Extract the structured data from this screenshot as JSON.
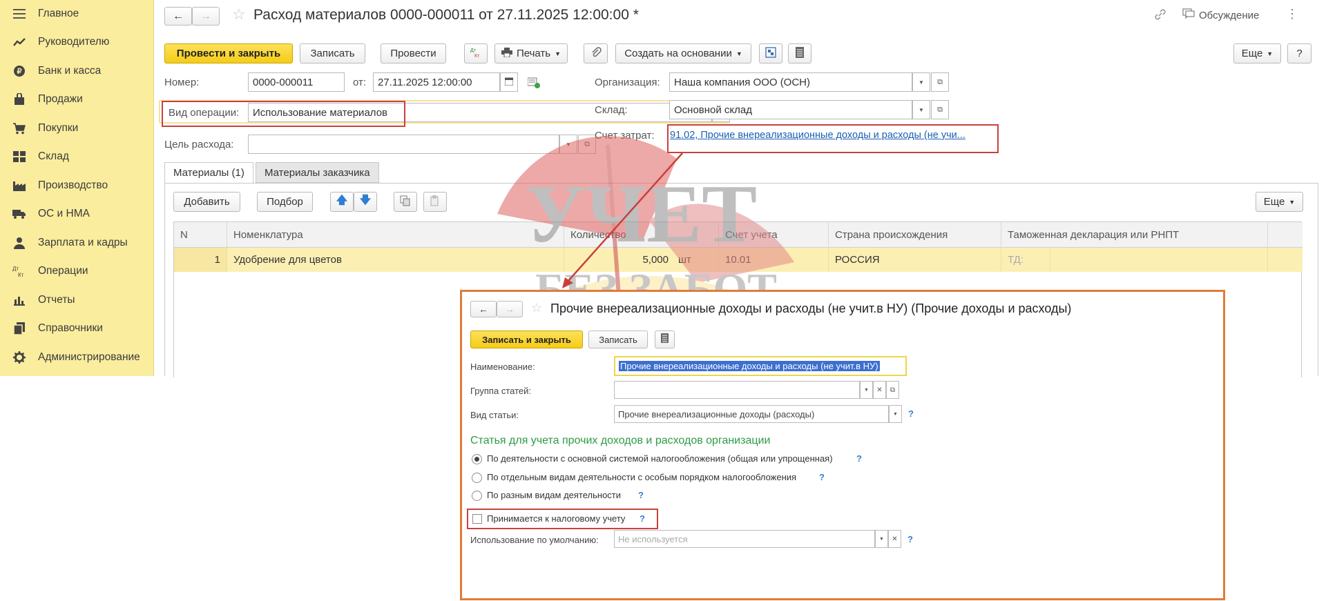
{
  "sidebar": {
    "items": [
      {
        "label": "Главное",
        "icon": "menu-icon"
      },
      {
        "label": "Руководителю",
        "icon": "trend-up-icon"
      },
      {
        "label": "Банк и касса",
        "icon": "coin-icon"
      },
      {
        "label": "Продажи",
        "icon": "shopping-bag-icon"
      },
      {
        "label": "Покупки",
        "icon": "cart-icon"
      },
      {
        "label": "Склад",
        "icon": "warehouse-icon"
      },
      {
        "label": "Производство",
        "icon": "factory-icon"
      },
      {
        "label": "ОС и НМА",
        "icon": "truck-icon"
      },
      {
        "label": "Зарплата и кадры",
        "icon": "person-icon"
      },
      {
        "label": "Операции",
        "icon": "dt-kt-icon"
      },
      {
        "label": "Отчеты",
        "icon": "bar-chart-icon"
      },
      {
        "label": "Справочники",
        "icon": "books-icon"
      },
      {
        "label": "Администрирование",
        "icon": "gear-icon"
      }
    ]
  },
  "header": {
    "title": "Расход материалов 0000-000011 от 27.11.2025 12:00:00 *",
    "discussion": "Обсуждение"
  },
  "toolbar": {
    "post_close": "Провести и закрыть",
    "save": "Записать",
    "post": "Провести",
    "dtkt": "Дт Кт",
    "print": "Печать",
    "create_based": "Создать на основании",
    "more": "Еще",
    "help": "?"
  },
  "form": {
    "number_label": "Номер:",
    "number_value": "0000-000011",
    "date_label": "от:",
    "date_value": "27.11.2025 12:00:00",
    "operation_label": "Вид операции:",
    "operation_value": "Использование материалов",
    "purpose_label": "Цель расхода:",
    "purpose_value": "",
    "org_label": "Организация:",
    "org_value": "Наша компания ООО (ОСН)",
    "warehouse_label": "Склад:",
    "warehouse_value": "Основной склад",
    "account_label": "Счет затрат:",
    "account_value": "91.02, Прочие внереализационные доходы и расходы (не учи..."
  },
  "tabs": [
    {
      "label": "Материалы (1)"
    },
    {
      "label": "Материалы заказчика"
    }
  ],
  "table_toolbar": {
    "add": "Добавить",
    "pick": "Подбор",
    "more": "Еще"
  },
  "table": {
    "headers": [
      "N",
      "Номенклатура",
      "Количество",
      "Счет учета",
      "Страна происхождения",
      "Таможенная декларация или РНПТ"
    ],
    "rows": [
      {
        "n": "1",
        "name": "Удобрение для цветов",
        "qty": "5,000",
        "unit": "шт",
        "account": "10.01",
        "country": "РОССИЯ",
        "customs": "ТД:"
      }
    ]
  },
  "popup": {
    "title": "Прочие внереализационные доходы и расходы (не учит.в НУ) (Прочие доходы и расходы)",
    "save_close": "Записать и закрыть",
    "save": "Записать",
    "name_label": "Наименование:",
    "name_value": "Прочие внереализационные доходы и расходы (не учит.в НУ)",
    "group_label": "Группа статей:",
    "group_value": "",
    "kind_label": "Вид статьи:",
    "kind_value": "Прочие внереализационные доходы (расходы)",
    "section_title": "Статья для учета прочих доходов и расходов организации",
    "radios": [
      {
        "label": "По деятельности с основной системой налогообложения (общая или упрощенная)",
        "checked": true
      },
      {
        "label": "По отдельным видам деятельности с особым порядком налогообложения",
        "checked": false
      },
      {
        "label": "По разным видам деятельности",
        "checked": false
      }
    ],
    "tax_checkbox_label": "Принимается к налоговому учету",
    "tax_checked": false,
    "default_label": "Использование по умолчанию:",
    "default_placeholder": "Не используется",
    "help": "?"
  },
  "watermark": {
    "line1": "УЧЕТ",
    "line2": "БЕЗ ЗАБОТ"
  },
  "colors": {
    "sidebar_bg": "#fbed9e",
    "primary_button": "#f6cc17",
    "highlight_box": "#c9403b",
    "popup_border": "#e07b39",
    "link": "#1a5fb4",
    "section_title": "#2e9a44"
  }
}
